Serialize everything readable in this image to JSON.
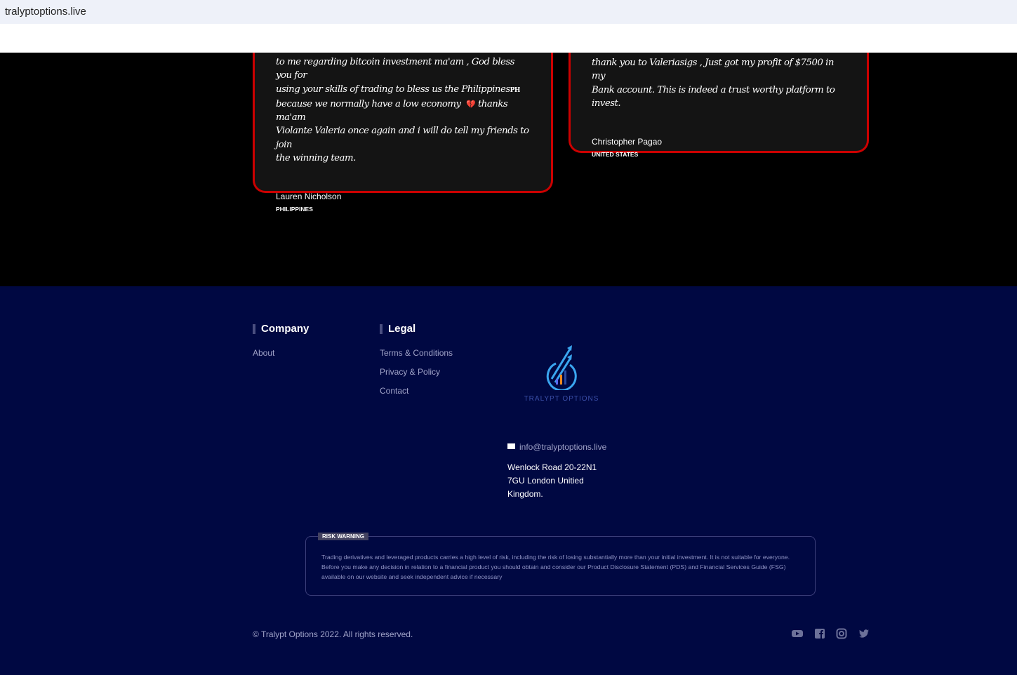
{
  "browser": {
    "url": "tralyptoptions.live"
  },
  "testimonials": [
    {
      "quote_lines": [
        "to me regarding bitcoin investment ma'am , God bless you for",
        "using your skills of trading to bless us the Philippines",
        "because we normally have a low economy",
        "Violante Valeria once again and i will do tell my friends to join",
        "the winning team."
      ],
      "flag_text": "PH",
      "emoji": "💔",
      "quote_after_emoji": " thanks ma'am",
      "name": "Lauren Nicholson",
      "country": "PHILIPPINES"
    },
    {
      "quote_lines": [
        "thank you to Valeriasigs , Just got my profit of $7500 in my",
        "Bank account. This is indeed a trust worthy platform to invest."
      ],
      "name": "Christopher Pagao",
      "country": "UNITED STATES"
    }
  ],
  "footer": {
    "company": {
      "title": "Company",
      "links": [
        "About"
      ]
    },
    "legal": {
      "title": "Legal",
      "links": [
        "Terms & Conditions",
        "Privacy & Policy",
        "Contact"
      ]
    },
    "logo_text": "TRALYPT OPTIONS",
    "email": "info@tralyptoptions.live",
    "address_lines": [
      "Wenlock Road 20-22N1",
      "7GU London Unitied",
      "Kingdom."
    ],
    "risk": {
      "label": "RISK WARNING",
      "text": "Trading derivatives and leveraged products carries a high level of risk, including the risk of losing substantially more than your initial investment. It is not suitable for everyone. Before you make any decision in relation to a financial product you should obtain and consider our Product Disclosure Statement (PDS) and Financial Services Guide (FSG) available on our website and seek independent advice if necessary"
    },
    "copyright": "© Tralypt Options 2022. All rights reserved.",
    "social": [
      "youtube-icon",
      "facebook-icon",
      "instagram-icon",
      "twitter-icon"
    ]
  }
}
